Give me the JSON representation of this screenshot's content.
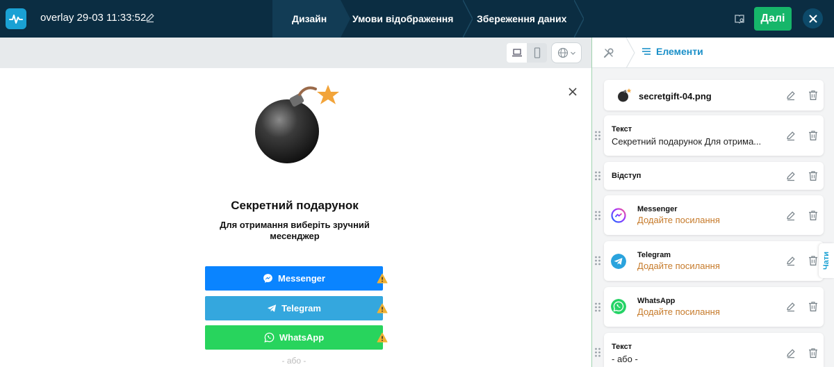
{
  "header": {
    "project_title": "overlay 29-03 11:33:52",
    "steps": [
      "Дизайн",
      "Умови відображення",
      "Збереження даних"
    ],
    "next_label": "Далі"
  },
  "colors": {
    "topbar": "#0b2d42",
    "accent": "#1aa1d4",
    "next": "#16b66a",
    "messenger": "#0a84ff",
    "telegram": "#34a7de",
    "whatsapp": "#28d45d",
    "link_orange": "#c67a2a"
  },
  "preview": {
    "title": "Секретний подарунок",
    "subtitle": "Для отримання виберіть зручний месенджер",
    "buttons": [
      {
        "label": "Messenger",
        "icon": "messenger-icon"
      },
      {
        "label": "Telegram",
        "icon": "telegram-icon"
      },
      {
        "label": "WhatsApp",
        "icon": "whatsapp-icon"
      }
    ],
    "or_text": "- або -"
  },
  "panel": {
    "tab_label": "Елементи",
    "chats_label": "Чати",
    "items": [
      {
        "type": "image",
        "name": "secretgift-04.png"
      },
      {
        "type": "Текст",
        "text": "Секретний подарунок Для отрима..."
      },
      {
        "type": "Відступ"
      },
      {
        "type": "Messenger",
        "link": "Додайте посилання"
      },
      {
        "type": "Telegram",
        "link": "Додайте посилання"
      },
      {
        "type": "WhatsApp",
        "link": "Додайте посилання"
      },
      {
        "type": "Текст",
        "text": "- або -"
      }
    ]
  }
}
